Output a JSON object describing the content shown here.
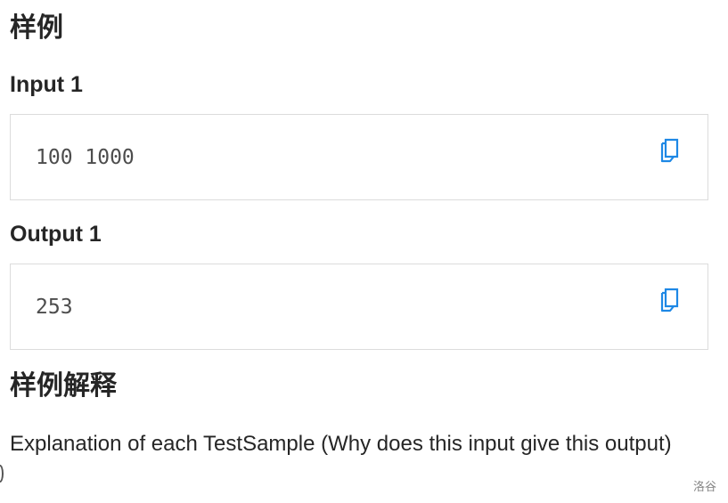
{
  "sections": {
    "samples_heading": "样例",
    "explanation_heading": "样例解释"
  },
  "samples": [
    {
      "input_label": "Input 1",
      "input_value": "100 1000",
      "output_label": "Output 1",
      "output_value": "253"
    }
  ],
  "explanation": {
    "text": "Explanation of each TestSample (Why does this input give this output)"
  },
  "watermark": "洛谷",
  "icons": {
    "copy": "copy-icon"
  },
  "colors": {
    "accent": "#1e88e5",
    "border": "#dcdcdc",
    "text": "#262626"
  }
}
